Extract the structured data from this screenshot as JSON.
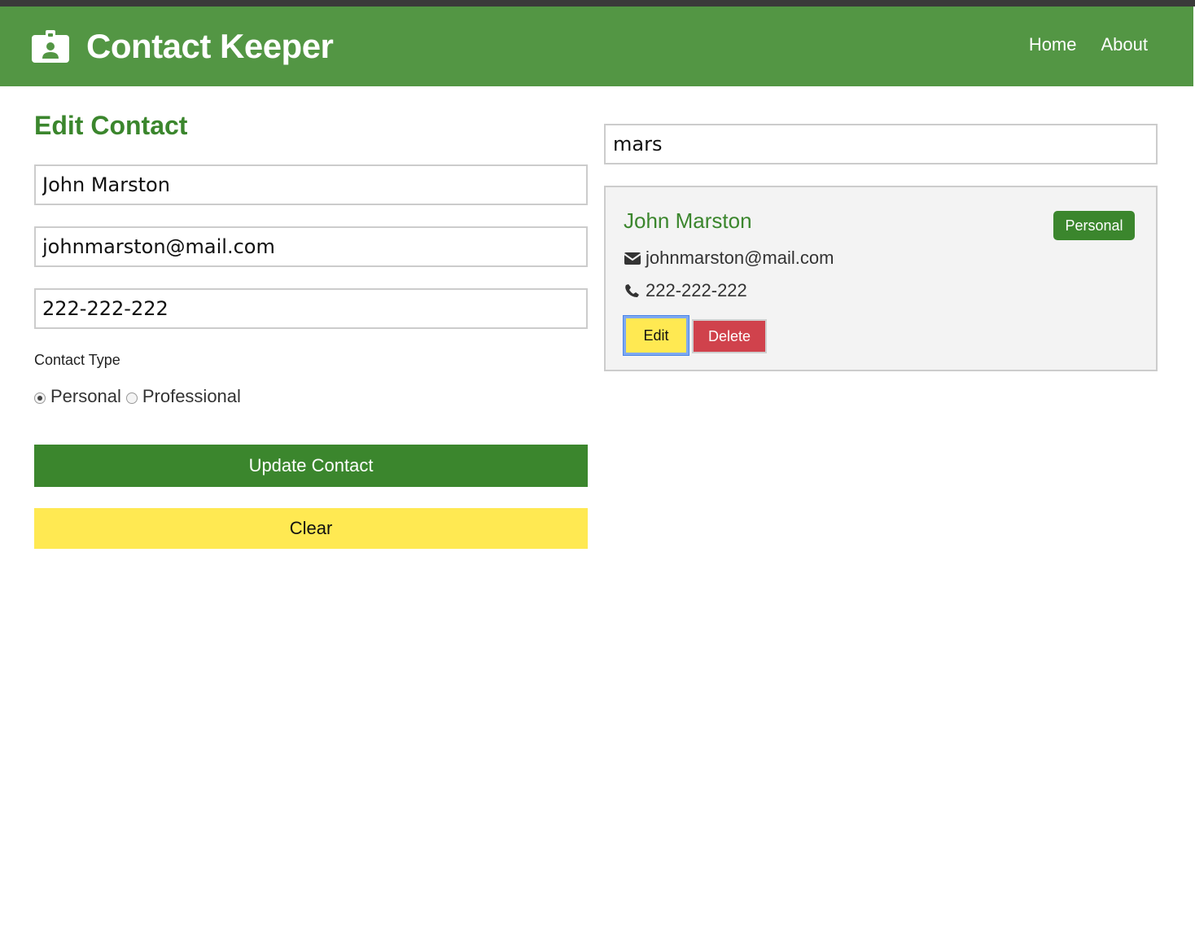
{
  "navbar": {
    "brand_icon": "id-badge-icon",
    "title": "Contact Keeper",
    "links": [
      {
        "label": "Home"
      },
      {
        "label": "About"
      }
    ],
    "color": "#539644"
  },
  "form": {
    "title": "Edit Contact",
    "name_value": "John Marston",
    "email_value": "johnmarston@mail.com",
    "phone_value": "222-222-222",
    "type_label": "Contact Type",
    "type_options": [
      {
        "label": "Personal",
        "checked": true
      },
      {
        "label": "Professional",
        "checked": false
      }
    ],
    "submit_label": "Update Contact",
    "clear_label": "Clear"
  },
  "filter": {
    "value": "mars"
  },
  "contacts": [
    {
      "name": "John Marston",
      "type_badge": "Personal",
      "email": "johnmarston@mail.com",
      "email_icon": "envelope-icon",
      "phone": "222-222-222",
      "phone_icon": "phone-icon",
      "edit_label": "Edit",
      "delete_label": "Delete"
    }
  ],
  "colors": {
    "primary": "#3b862d",
    "warning": "#ffe952",
    "danger": "#d0424c",
    "card_bg": "#f3f3f3"
  }
}
